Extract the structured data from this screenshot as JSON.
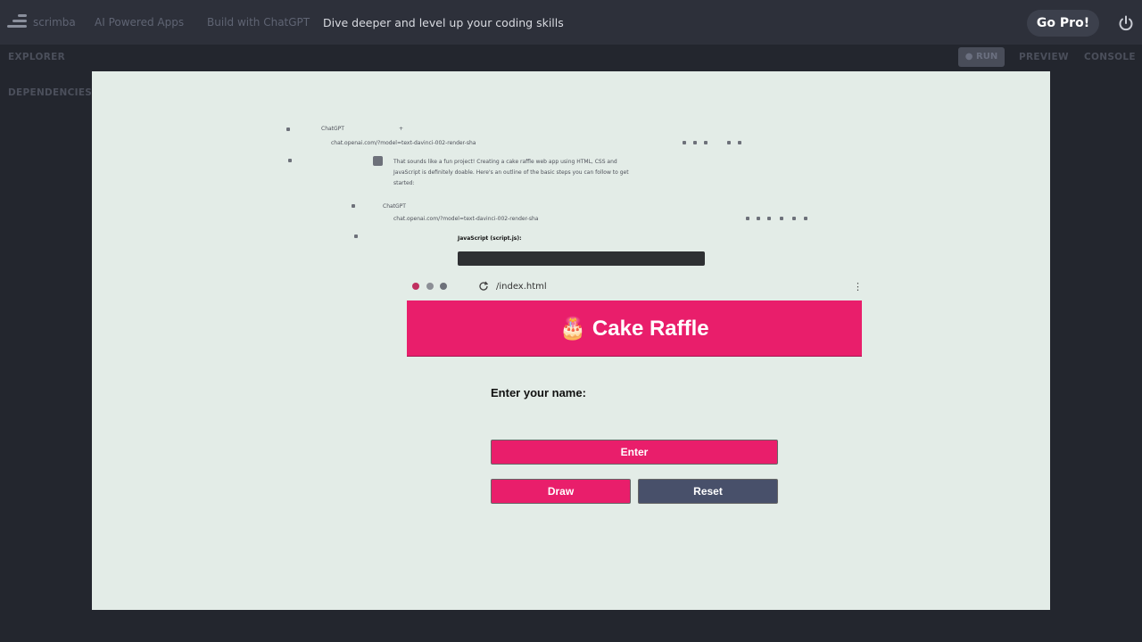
{
  "topbar": {
    "breadcrumbs": [
      "scrimba",
      "AI Powered Apps",
      "Build with ChatGPT"
    ],
    "tagline": "Dive deeper and level up your coding skills",
    "gopro_label": "Go Pro!"
  },
  "sidebar": {
    "explorer": "EXPLORER",
    "dependencies": "DEPENDENCIES"
  },
  "right_tabs": {
    "run": "RUN",
    "preview": "PREVIEW",
    "console": "CONSOLE"
  },
  "embedded": {
    "screenshot1": {
      "tab": "ChatGPT",
      "url": "chat.openai.com/?model=text-davinci-002-render-sha",
      "line1": "That sounds like a fun project! Creating a cake raffle web app using HTML, CSS and",
      "line2": "JavaScript is definitely doable. Here's an outline of the basic steps you can follow to get",
      "line3": "started:"
    },
    "screenshot2": {
      "tab": "ChatGPT",
      "url": "chat.openai.com/?model=text-davinci-002-render-sha",
      "heading": "JavaScript (script.js):"
    }
  },
  "app": {
    "url": "/index.html",
    "title": "🎂 Cake Raffle",
    "name_label": "Enter your name:",
    "enter_label": "Enter",
    "draw_label": "Draw",
    "reset_label": "Reset"
  },
  "colors": {
    "accent": "#e91e6b",
    "reset": "#48506a",
    "preview_bg": "#e3ece7"
  }
}
